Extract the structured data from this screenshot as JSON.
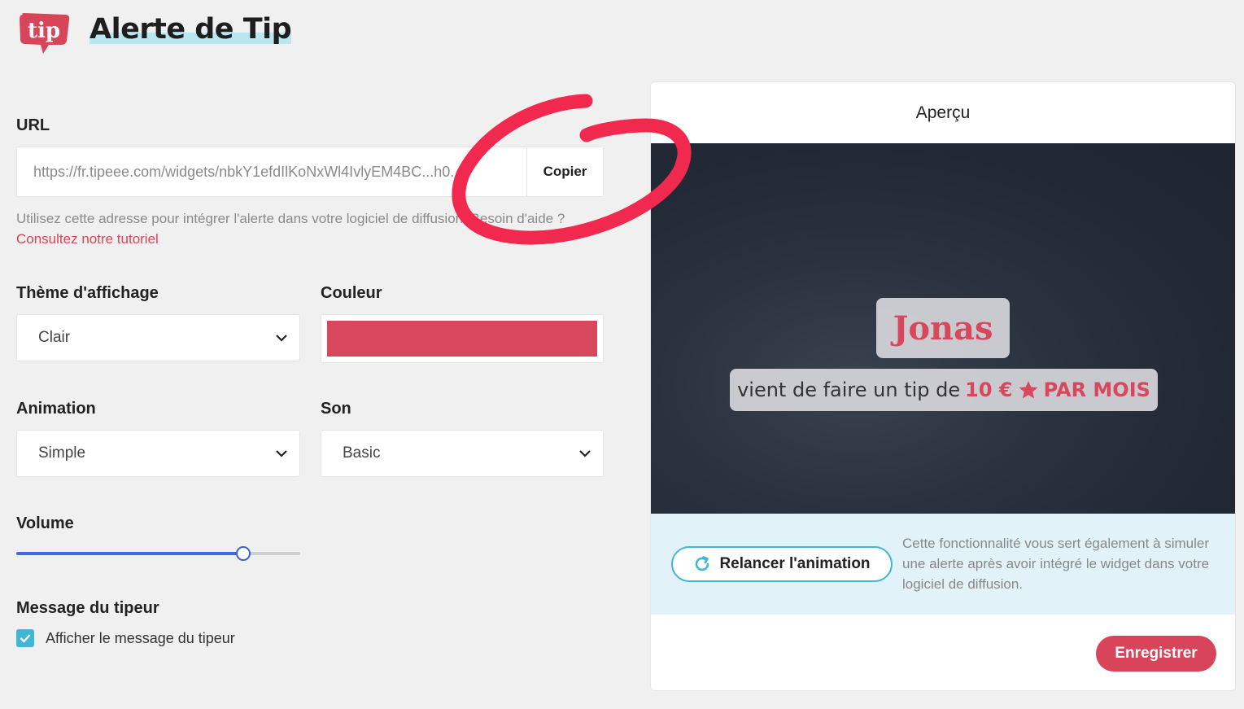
{
  "header": {
    "logo_text": "tip",
    "title": "Alerte de Tip"
  },
  "url_section": {
    "label": "URL",
    "value": "https://fr.tipeee.com/widgets/nbkY1efdIlKoNxWl4IvlyEM4BC...h0...",
    "copy_label": "Copier",
    "help_text": "Utilisez cette adresse pour intégrer l'alerte dans votre logiciel de diffusion. Besoin d'aide ? ",
    "help_link": "Consultez notre tutoriel"
  },
  "theme": {
    "label": "Thème d'affichage",
    "value": "Clair"
  },
  "color": {
    "label": "Couleur",
    "value": "#d8485c"
  },
  "animation": {
    "label": "Animation",
    "value": "Simple"
  },
  "sound": {
    "label": "Son",
    "value": "Basic"
  },
  "volume": {
    "label": "Volume",
    "percent": 80
  },
  "tipper_message": {
    "label": "Message du tipeur",
    "checkbox_label": "Afficher le message du tipeur",
    "checked": true
  },
  "preview": {
    "title": "Aperçu",
    "name": "Jonas",
    "message_prefix": "vient de faire un tip de",
    "amount": "10 €",
    "frequency": "PAR MOIS",
    "replay_label": "Relancer l'animation",
    "info_text": "Cette fonctionnalité vous sert également à simuler une alerte après avoir intégré le widget dans votre logiciel de diffusion.",
    "save_label": "Enregistrer"
  },
  "colors": {
    "accent": "#d8455a",
    "teal": "#3fb6d3",
    "slider": "#4169e1"
  }
}
